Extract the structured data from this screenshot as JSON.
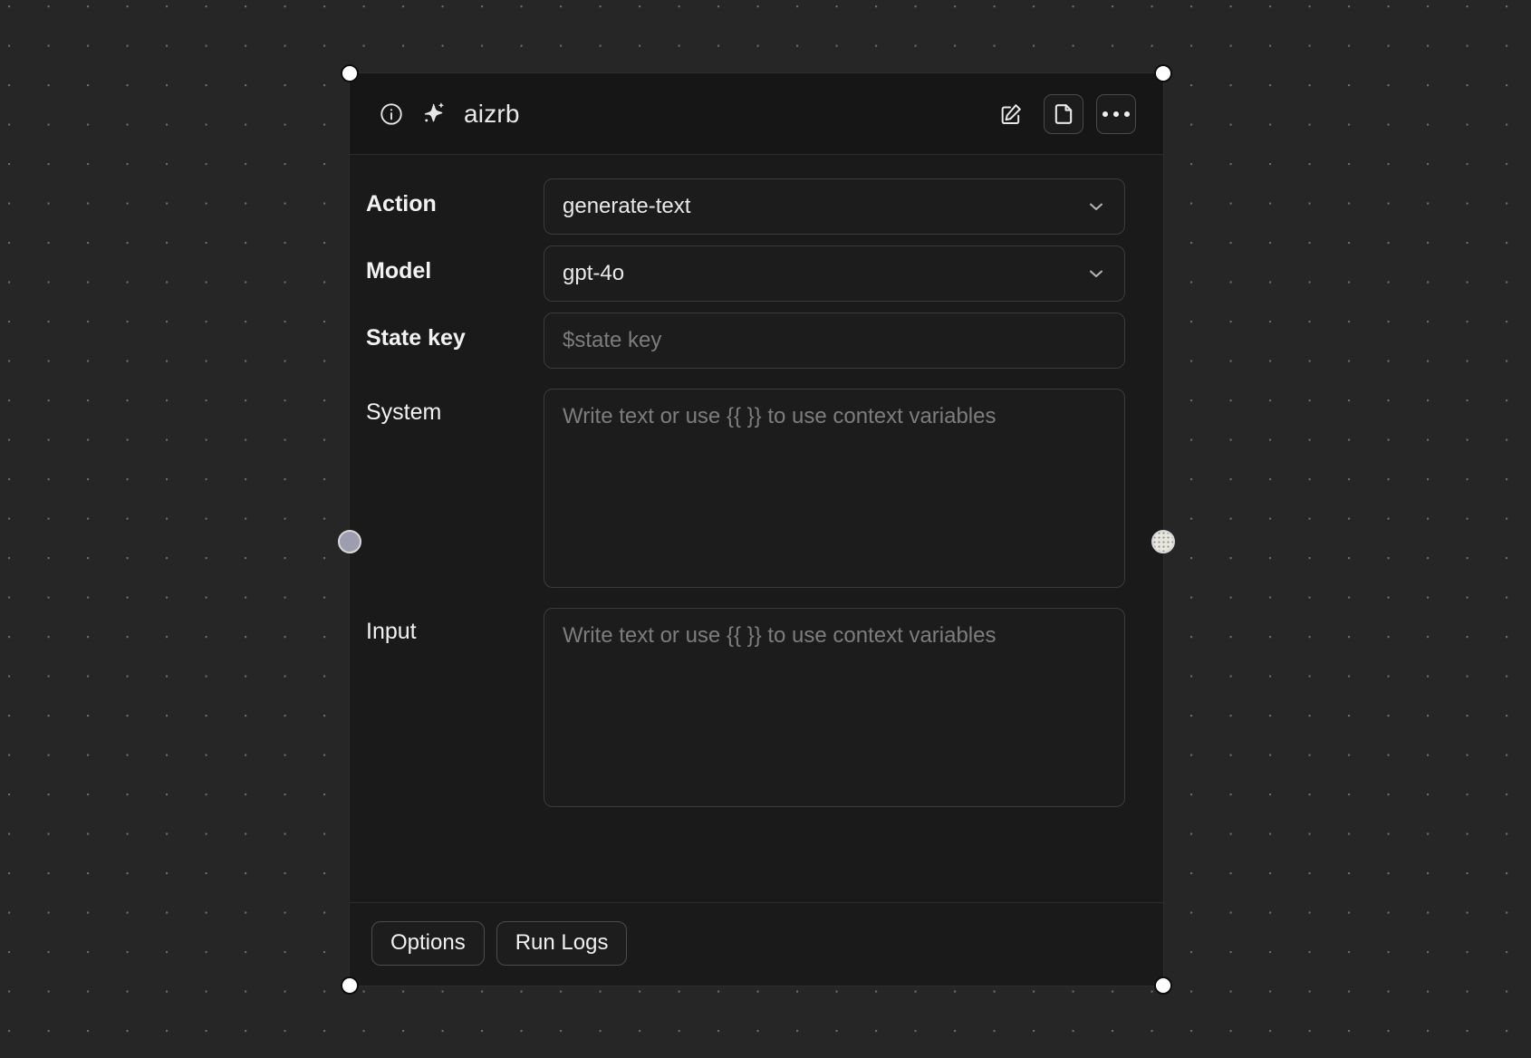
{
  "canvas": {
    "background_color": "#262626",
    "dot_color": "#6a6a6a",
    "grid_spacing_px": 43
  },
  "node": {
    "header": {
      "title": "aizrb",
      "info_icon": "info-circle-icon",
      "type_icon": "sparkle-icon",
      "actions": [
        {
          "name": "edit-button",
          "icon": "pencil-square-icon",
          "bordered": false
        },
        {
          "name": "file-button",
          "icon": "file-icon",
          "bordered": true
        },
        {
          "name": "more-options-button",
          "icon": "ellipsis-icon",
          "bordered": true
        }
      ]
    },
    "fields": [
      {
        "label": "Action",
        "kind": "select",
        "value": "generate-text",
        "placeholder": "",
        "chevron": "chevron-down-icon"
      },
      {
        "label": "Model",
        "kind": "select",
        "value": "gpt-4o",
        "placeholder": "",
        "chevron": "chevron-down-icon"
      },
      {
        "label": "State key",
        "kind": "text",
        "value": "",
        "placeholder": "$state key"
      },
      {
        "label": "System",
        "kind": "textarea",
        "value": "",
        "placeholder": "Write text or use {{ }} to use context variables"
      },
      {
        "label": "Input",
        "kind": "textarea",
        "value": "",
        "placeholder": "Write text or use {{ }} to use context variables"
      }
    ],
    "footer": {
      "buttons": [
        {
          "label": "Options",
          "name": "options-button"
        },
        {
          "label": "Run Logs",
          "name": "run-logs-button"
        }
      ]
    },
    "selection": {
      "selected": true,
      "corner_handle_color": "#ffffff",
      "input_port_color": "#9d9db0",
      "output_port_color": "#e7e7dd"
    },
    "colors": {
      "header_bg": "#161616",
      "body_bg": "#1a1a1a",
      "field_bg": "#1c1c1c",
      "field_border": "#3c3c3c",
      "text": "#eaeaea",
      "placeholder": "#7d7d7d"
    }
  }
}
